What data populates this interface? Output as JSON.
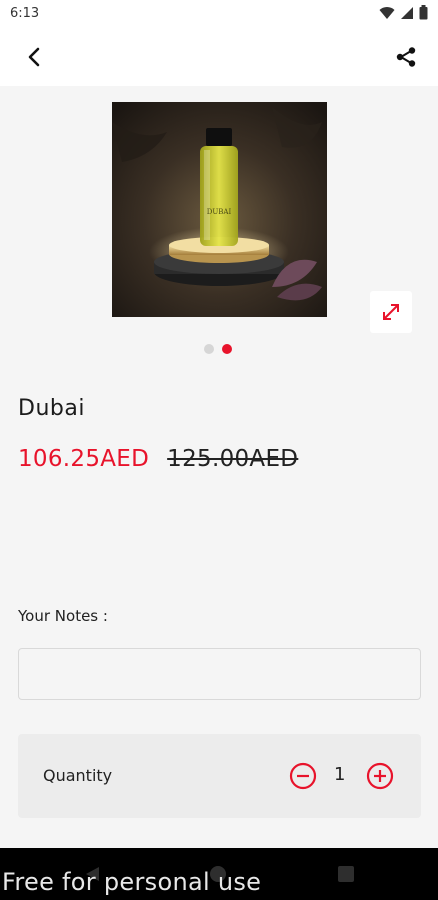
{
  "status_bar": {
    "time": "6:13",
    "icons": [
      "wifi-icon",
      "signal-icon",
      "battery-icon"
    ]
  },
  "app_bar": {
    "back_icon": "chevron-left-icon",
    "share_icon": "share-icon"
  },
  "product": {
    "image_icon": "perfume-bottle-image",
    "expand_icon": "expand-icon",
    "pager": {
      "count": 2,
      "active_index": 1
    },
    "name": "Dubai",
    "sale_price": "106.25AED",
    "original_price": "125.00AED"
  },
  "notes": {
    "label": "Your Notes :",
    "value": "",
    "placeholder": ""
  },
  "quantity": {
    "label": "Quantity",
    "value": "1",
    "minus_icon": "minus-circle-icon",
    "plus_icon": "plus-circle-icon"
  },
  "nav_bar": {
    "icons": [
      "nav-back-icon",
      "nav-home-icon",
      "nav-recents-icon"
    ]
  },
  "watermark": "Free for personal use",
  "colors": {
    "accent": "#e8132b",
    "background": "#f5f5f5",
    "card": "#ececec"
  }
}
